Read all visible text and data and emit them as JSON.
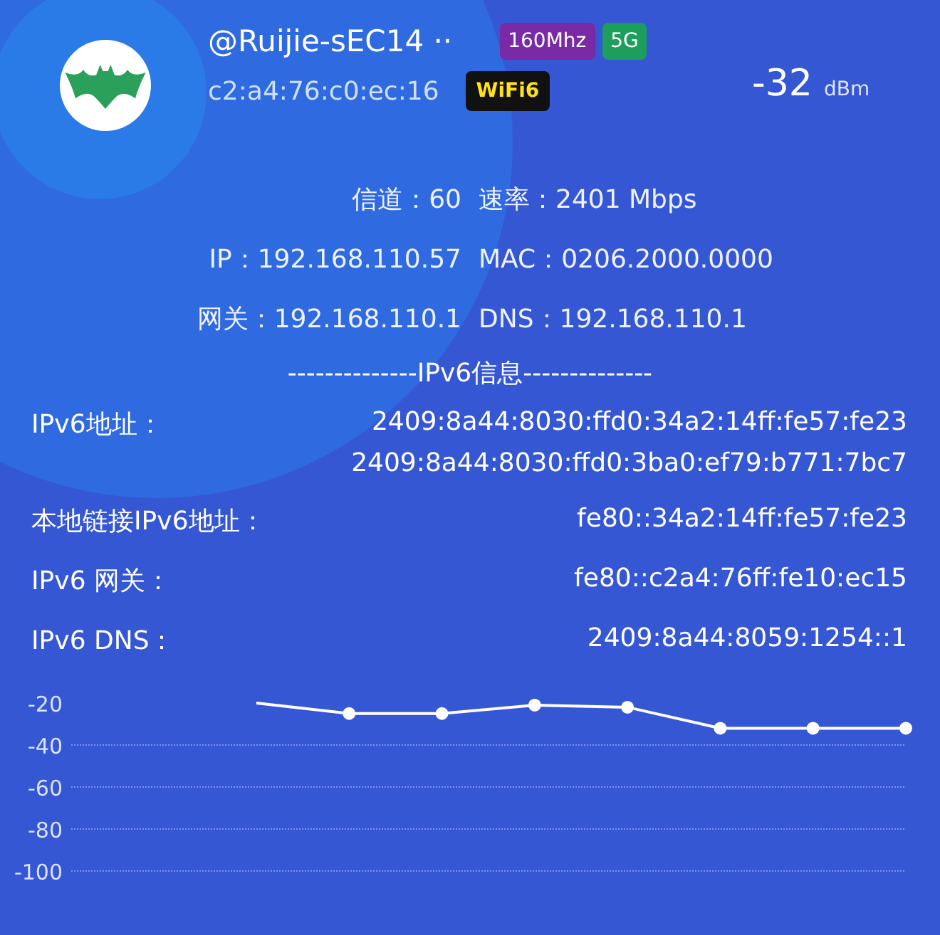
{
  "network": {
    "ssid": "@Ruijie-sEC14 ··",
    "mac": "c2:a4:76:c0:ec:16",
    "tags": [
      {
        "label": "160Mhz",
        "color": "#7b2aa6",
        "kind": "plain"
      },
      {
        "label": "5G",
        "color": "#1e9e5c",
        "kind": "plain"
      },
      {
        "label": "WiFi6",
        "color": "#111111",
        "kind": "emphasis"
      }
    ],
    "signal": {
      "value": "-32",
      "unit": "dBm"
    }
  },
  "info_rows": [
    {
      "left": "信道：60",
      "right": "速率：2401 Mbps"
    },
    {
      "left": "IP：192.168.110.57",
      "right": "MAC：0206.2000.0000"
    },
    {
      "left": "网关：192.168.110.1",
      "right": "DNS：192.168.110.1"
    }
  ],
  "ipv6_heading": "--------------IPv6信息--------------",
  "ipv6": [
    {
      "label": "IPv6地址：",
      "values": [
        "2409:8a44:8030:ffd0:34a2:14ff:fe57:fe23",
        "2409:8a44:8030:ffd0:3ba0:ef79:b771:7bc7"
      ]
    },
    {
      "label": "本地链接IPv6地址：",
      "values": [
        "fe80::34a2:14ff:fe57:fe23"
      ]
    },
    {
      "label": "IPv6 网关：",
      "values": [
        "fe80::c2a4:76ff:fe10:ec15"
      ]
    },
    {
      "label": "IPv6 DNS：",
      "values": [
        "2409:8a44:8059:1254::1"
      ]
    }
  ],
  "chart": {
    "chart_data": {
      "type": "line",
      "grid": true,
      "ylim": [
        -100,
        -20
      ],
      "yticks": [
        -20,
        -40,
        -60,
        -80,
        -100
      ],
      "series": [
        {
          "color": "#ffffff",
          "marker": true,
          "values": [
            -20,
            -25,
            -25,
            -21,
            -22,
            -32,
            -32,
            -32
          ]
        }
      ]
    }
  }
}
